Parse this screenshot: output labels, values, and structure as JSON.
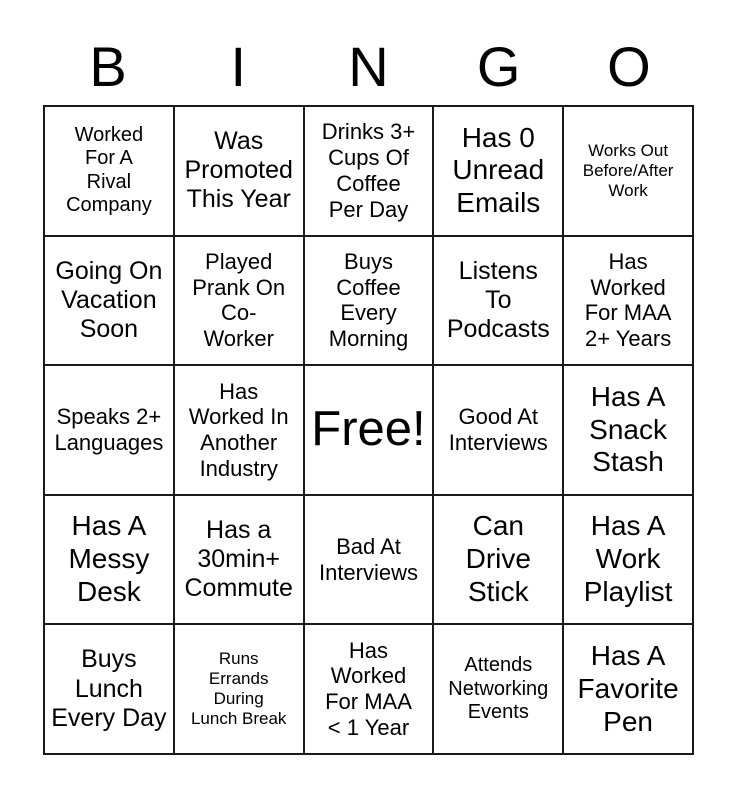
{
  "header": {
    "letters": [
      "B",
      "I",
      "N",
      "G",
      "O"
    ]
  },
  "grid": {
    "rows": 5,
    "columns": 5,
    "border_color": "#1a1a1a",
    "background_color": "#ffffff",
    "text_color": "#000000",
    "cells": [
      {
        "text": "Worked\nFor A\nRival\nCompany",
        "size": "s"
      },
      {
        "text": "Was\nPromoted\nThis Year",
        "size": "l"
      },
      {
        "text": "Drinks 3+\nCups Of\nCoffee\nPer Day",
        "size": "m"
      },
      {
        "text": "Has 0\nUnread\nEmails",
        "size": "xl"
      },
      {
        "text": "Works Out\nBefore/After\nWork",
        "size": "xs"
      },
      {
        "text": "Going On\nVacation\nSoon",
        "size": "l"
      },
      {
        "text": "Played\nPrank On\nCo-\nWorker",
        "size": "m"
      },
      {
        "text": "Buys\nCoffee\nEvery\nMorning",
        "size": "m"
      },
      {
        "text": "Listens\nTo\nPodcasts",
        "size": "l"
      },
      {
        "text": "Has\nWorked\nFor MAA\n2+ Years",
        "size": "m"
      },
      {
        "text": "Speaks 2+\nLanguages",
        "size": "m"
      },
      {
        "text": "Has\nWorked In\nAnother\nIndustry",
        "size": "m"
      },
      {
        "text": "Free!",
        "size": "free"
      },
      {
        "text": "Good At\nInterviews",
        "size": "m"
      },
      {
        "text": "Has A\nSnack\nStash",
        "size": "xl"
      },
      {
        "text": "Has A\nMessy\nDesk",
        "size": "xl"
      },
      {
        "text": "Has a\n30min+\nCommute",
        "size": "l"
      },
      {
        "text": "Bad At\nInterviews",
        "size": "m"
      },
      {
        "text": "Can\nDrive\nStick",
        "size": "xl"
      },
      {
        "text": "Has A\nWork\nPlaylist",
        "size": "xl"
      },
      {
        "text": "Buys\nLunch\nEvery Day",
        "size": "l"
      },
      {
        "text": "Runs\nErrands\nDuring\nLunch Break",
        "size": "xs"
      },
      {
        "text": "Has\nWorked\nFor MAA\n< 1 Year",
        "size": "m"
      },
      {
        "text": "Attends\nNetworking\nEvents",
        "size": "s"
      },
      {
        "text": "Has A\nFavorite\nPen",
        "size": "xl"
      }
    ]
  }
}
